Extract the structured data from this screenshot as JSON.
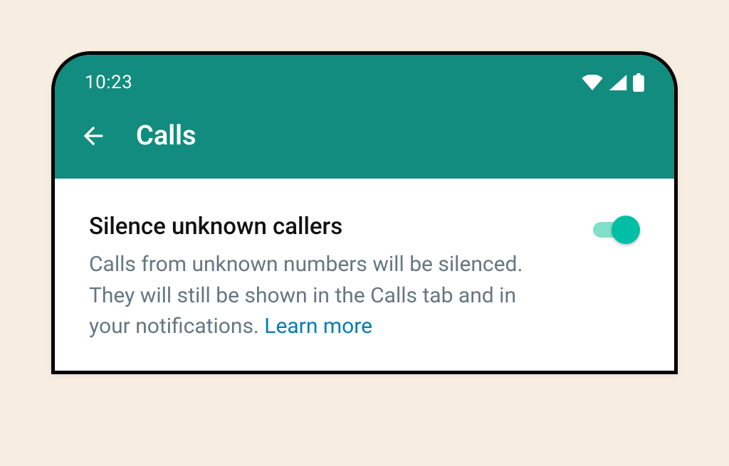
{
  "status_bar": {
    "time": "10:23"
  },
  "app_bar": {
    "title": "Calls"
  },
  "setting": {
    "title": "Silence unknown callers",
    "description": "Calls from unknown numbers will be silenced. They will still be shown in the Calls tab and in your notifications. ",
    "learn_more": "Learn more",
    "toggle_on": true
  },
  "colors": {
    "header": "#128c7e",
    "toggle_knob": "#00bfa5",
    "toggle_track": "#81e0c9",
    "link": "#027eb5",
    "background": "#f8ede1"
  }
}
